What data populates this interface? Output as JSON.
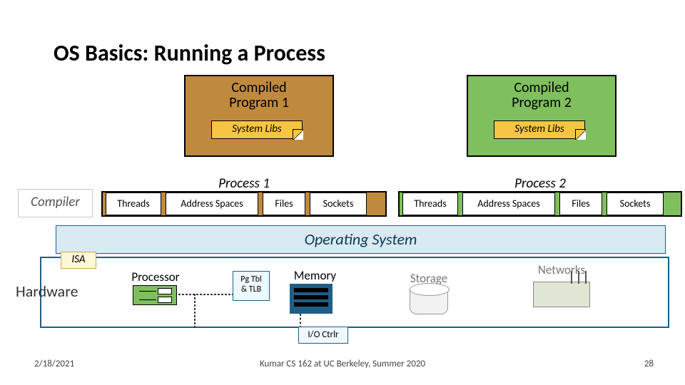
{
  "title": "OS Basics: Running a Process",
  "programs": [
    {
      "label": "Compiled\nProgram 1",
      "libs": "System Libs"
    },
    {
      "label": "Compiled\nProgram 2",
      "libs": "System Libs"
    }
  ],
  "processes": [
    {
      "label": "Process 1",
      "cells": [
        "Threads",
        "Address Spaces",
        "Files",
        "Sockets"
      ]
    },
    {
      "label": "Process 2",
      "cells": [
        "Threads",
        "Address Spaces",
        "Files",
        "Sockets"
      ]
    }
  ],
  "os_label": "Operating System",
  "compiler": "Compiler",
  "isa": "ISA",
  "hardware_label": "Hardware",
  "hw": {
    "processor": "Processor",
    "pgtbl": "Pg Tbl\n& TLB",
    "memory": "Memory",
    "storage": "Storage",
    "networks": "Networks",
    "ioctrl": "I/O Ctrlr"
  },
  "footer": {
    "date": "2/18/2021",
    "center": "Kumar CS 162 at UC Berkeley, Summer 2020",
    "page": "28"
  }
}
